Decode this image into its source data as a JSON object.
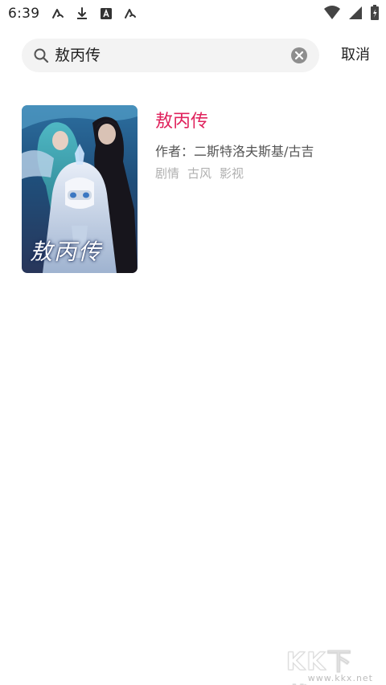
{
  "status_bar": {
    "time": "6:39",
    "left_icons": [
      "a-notification-icon",
      "download-icon",
      "a-box-icon",
      "a-notification-icon"
    ],
    "right_icons": [
      "wifi-icon",
      "signal-icon",
      "battery-charging-icon"
    ]
  },
  "search": {
    "query": "敖丙传",
    "cancel_label": "取消"
  },
  "result": {
    "cover_title": "敖丙传",
    "title": "敖丙传",
    "author": "作者：二斯特洛夫斯基/古吉",
    "tags": [
      "剧情",
      "古风",
      "影视"
    ]
  },
  "watermark": {
    "main": "KK下载",
    "sub": "www.kkx.net"
  },
  "colors": {
    "accent": "#e0245e",
    "search_bg": "#f3f3f3",
    "tag_text": "#b0b0b0"
  }
}
